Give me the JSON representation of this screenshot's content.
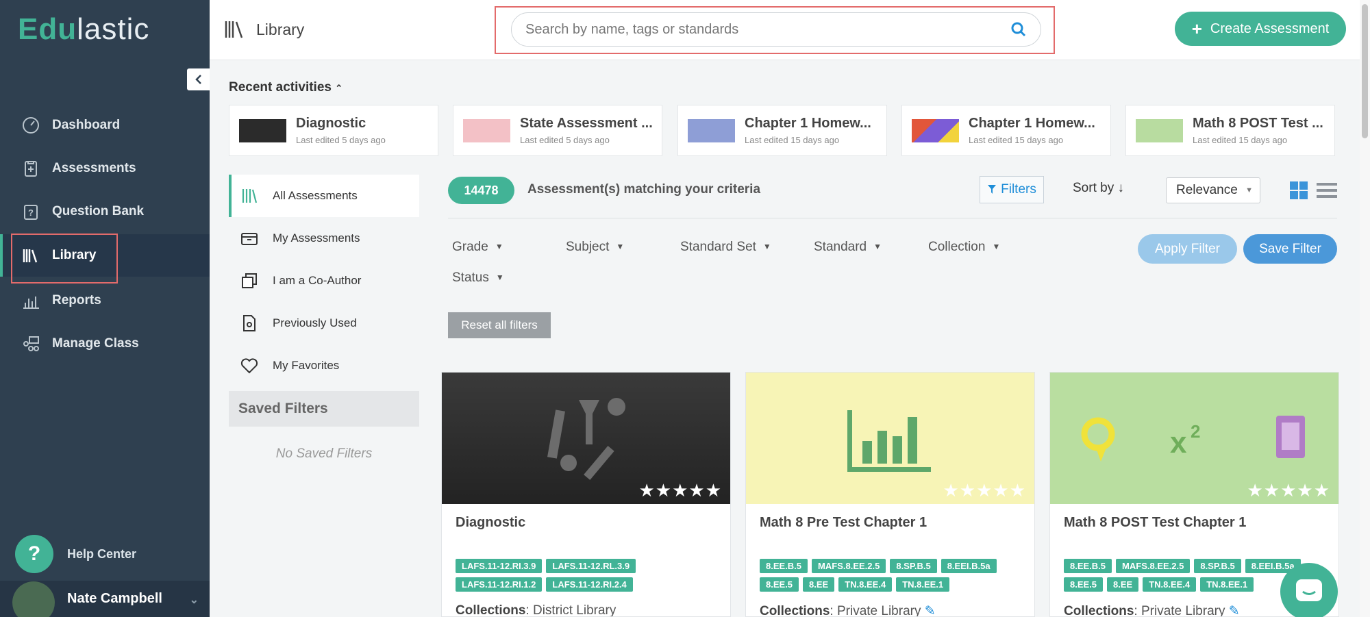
{
  "brand": {
    "part1": "Edu",
    "part2": "lastic"
  },
  "sidebar": {
    "items": [
      {
        "label": "Dashboard"
      },
      {
        "label": "Assessments"
      },
      {
        "label": "Question Bank"
      },
      {
        "label": "Library"
      },
      {
        "label": "Reports"
      },
      {
        "label": "Manage Class"
      }
    ],
    "active": "Library",
    "help_label": "Help Center",
    "help_icon": "?",
    "user_name": "Nate Campbell"
  },
  "header": {
    "title": "Library",
    "search_placeholder": "Search by name, tags or standards",
    "create_label": "Create Assessment",
    "create_plus": "+"
  },
  "recent": {
    "heading": "Recent activities",
    "items": [
      {
        "title": "Diagnostic",
        "sub": "Last edited 5 days ago",
        "thumb_color": "#2b2b2b"
      },
      {
        "title": "State Assessment ...",
        "sub": "Last edited 5 days ago",
        "thumb_color": "#f3c1c6"
      },
      {
        "title": "Chapter 1 Homew...",
        "sub": "Last edited 15 days ago",
        "thumb_color": "#8e9ed6"
      },
      {
        "title": "Chapter 1 Homew...",
        "sub": "Last edited 15 days ago",
        "thumb_color": "#9b7fd6"
      },
      {
        "title": "Math 8 POST Test ...",
        "sub": "Last edited 15 days ago",
        "thumb_color": "#b8dca0"
      }
    ]
  },
  "leftmenu": {
    "items": [
      {
        "label": "All Assessments"
      },
      {
        "label": "My Assessments"
      },
      {
        "label": "I am a Co-Author"
      },
      {
        "label": "Previously Used"
      },
      {
        "label": "My Favorites"
      }
    ],
    "saved_heading": "Saved Filters",
    "no_saved": "No Saved Filters"
  },
  "results": {
    "count": "14478",
    "label": "Assessment(s) matching your criteria",
    "filters_label": "Filters",
    "sort_label": "Sort by",
    "sort_value": "Relevance"
  },
  "filters": {
    "dropdowns": [
      "Grade",
      "Subject",
      "Standard Set",
      "Standard",
      "Collection",
      "Status"
    ],
    "apply_label": "Apply Filter",
    "save_label": "Save Filter",
    "reset_label": "Reset all filters"
  },
  "cards": [
    {
      "title": "Diagnostic",
      "bg": "#2f2f2f",
      "tags": [
        "LAFS.11-12.RI.3.9",
        "LAFS.11-12.RL.3.9",
        "LAFS.11-12.RI.1.2",
        "LAFS.11-12.RI.2.4"
      ],
      "collections_label": "Collections",
      "collection": "District Library",
      "rating": 5
    },
    {
      "title": "Math 8 Pre Test Chapter 1",
      "bg": "#f7f4b6",
      "tags": [
        "8.EE.B.5",
        "MAFS.8.EE.2.5",
        "8.SP.B.5",
        "8.EEI.B.5a",
        "8.EE.5",
        "8.EE",
        "TN.8.EE.4",
        "TN.8.EE.1"
      ],
      "collections_label": "Collections",
      "collection": "Private Library",
      "rating": 5
    },
    {
      "title": "Math 8 POST Test Chapter 1",
      "bg": "#b9dea0",
      "tags": [
        "8.EE.B.5",
        "MAFS.8.EE.2.5",
        "8.SP.B.5",
        "8.EEI.B.5a",
        "8.EE.5",
        "8.EE",
        "TN.8.EE.4",
        "TN.8.EE.1"
      ],
      "collections_label": "Collections",
      "collection": "Private Library",
      "rating": 5
    }
  ],
  "colors": {
    "accent": "#42b396",
    "sidebar": "#2f4050",
    "blue": "#4b98d9"
  }
}
